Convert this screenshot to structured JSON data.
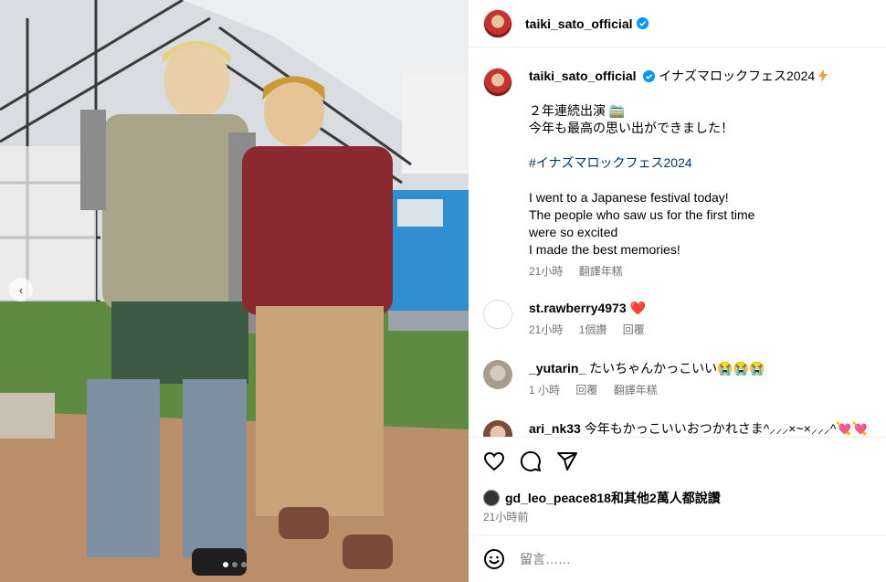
{
  "post": {
    "username": "taiki_sato_official",
    "caption_title": "イナズマロックフェス2024",
    "caption_lines": [
      "２年連続出演 🚞",
      "今年も最高の思い出ができました！"
    ],
    "hashtag": "#イナズマロックフェス2024",
    "caption_en": [
      "I went to a Japanese festival today!",
      "The people who saw us for the first time",
      "were so excited",
      "I made the best memories!"
    ],
    "caption_time": "21小時",
    "caption_translate": "翻譯年糕"
  },
  "comments": [
    {
      "user": "st.rawberry4973",
      "text": "❤️",
      "time": "21小時",
      "likes": "1個讚",
      "reply": "回覆"
    },
    {
      "user": "_yutarin_",
      "text": "たいちゃんかっこいい😭😭😭",
      "time": "1 小時",
      "reply": "回覆",
      "translate": "翻譯年糕"
    },
    {
      "user": "ari_nk33",
      "text": "今年もかっこいいおつかれさま^⸝⸝⸝×~×⸝⸝⸝^💘💘"
    }
  ],
  "likes": {
    "text": "gd_leo_peace818和其他2萬人都說讚"
  },
  "posted": "21小時前",
  "add_comment": {
    "placeholder": "留言……"
  },
  "carousel": {
    "prev_icon": "‹",
    "dots": 3,
    "active_dot": 0
  },
  "colors": {
    "verified": "#0095f6",
    "hashtag": "#00376b",
    "heart": "#ff3040"
  }
}
